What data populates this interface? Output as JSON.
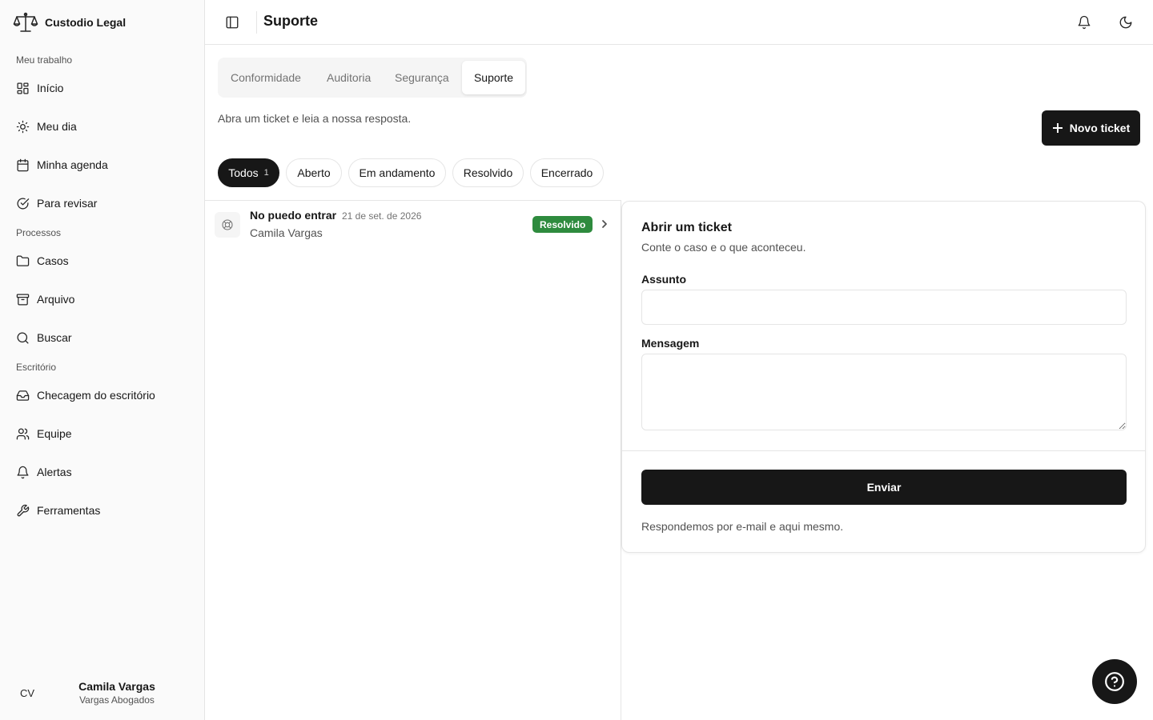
{
  "brand": {
    "name": "Custodio Legal",
    "icon": "scales-icon"
  },
  "sidebar": {
    "sections": [
      {
        "label": "Meu trabalho"
      },
      {
        "label": "Processos"
      },
      {
        "label": "Escritório"
      }
    ],
    "items": [
      {
        "label": "Início",
        "icon": "grid-icon"
      },
      {
        "label": "Meu dia",
        "icon": "sun-icon"
      },
      {
        "label": "Minha agenda",
        "icon": "calendar-icon"
      },
      {
        "label": "Para revisar",
        "icon": "check-circle-icon"
      },
      {
        "label": "Casos",
        "icon": "folder-icon"
      },
      {
        "label": "Arquivo",
        "icon": "archive-icon"
      },
      {
        "label": "Buscar",
        "icon": "search-icon"
      },
      {
        "label": "Checagem do escritório",
        "icon": "inbox-icon"
      },
      {
        "label": "Equipe",
        "icon": "users-icon"
      },
      {
        "label": "Alertas",
        "icon": "bell-icon"
      },
      {
        "label": "Ferramentas",
        "icon": "wrench-icon"
      }
    ],
    "user": {
      "initials": "CV",
      "name": "Camila Vargas",
      "org": "Vargas Abogados"
    }
  },
  "header": {
    "title": "Suporte"
  },
  "tabs": [
    {
      "label": "Conformidade"
    },
    {
      "label": "Auditoria"
    },
    {
      "label": "Segurança"
    },
    {
      "label": "Suporte",
      "active": true
    }
  ],
  "main": {
    "subtitle": "Abra um ticket e leia a nossa resposta.",
    "new_ticket_label": "Novo ticket"
  },
  "filters": [
    {
      "label": "Todos",
      "count": "1",
      "active": true
    },
    {
      "label": "Aberto"
    },
    {
      "label": "Em andamento"
    },
    {
      "label": "Resolvido"
    },
    {
      "label": "Encerrado"
    }
  ],
  "tickets": [
    {
      "subject": "No puedo entrar",
      "date": "21 de set. de 2026",
      "author": "Camila Vargas",
      "status": "Resolvido",
      "status_color": "#2e8b3e"
    }
  ],
  "form": {
    "title": "Abrir um ticket",
    "description": "Conte o caso e o que aconteceu.",
    "subject_label": "Assunto",
    "subject_value": "",
    "message_label": "Mensagem",
    "message_value": "",
    "submit_label": "Enviar",
    "note": "Respondemos por e-mail e aqui mesmo."
  },
  "colors": {
    "primary": "#171717",
    "success": "#2e8b3e",
    "sidebar_bg": "#fafafa",
    "border": "#e5e5e5"
  }
}
